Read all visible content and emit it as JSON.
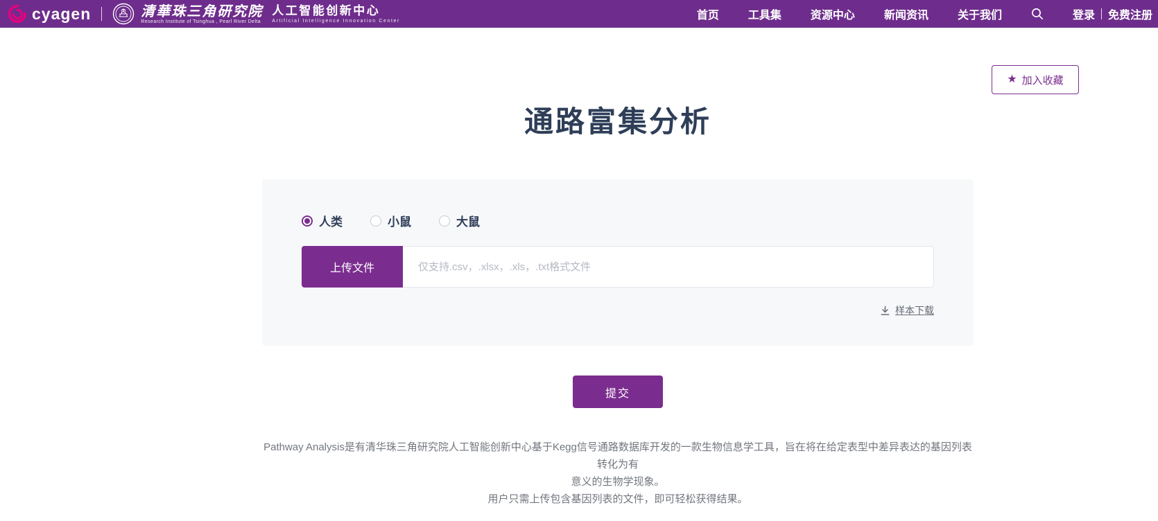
{
  "header": {
    "logo_text": "cyagen",
    "institute_name": "清華珠三角研究院",
    "institute_subtitle": "Research Institute of Tsinghua , Pearl River Delta",
    "center_name": "人工智能创新中心",
    "center_subtitle": "Artificial Intelligence Innovation Center",
    "nav": [
      "首页",
      "工具集",
      "资源中心",
      "新闻资讯",
      "关于我们"
    ],
    "login_label": "登录",
    "register_label": "免费注册"
  },
  "favorite_button": {
    "star_icon": "★",
    "label": "加入收藏"
  },
  "page_title": "通路富集分析",
  "form": {
    "species_options": [
      {
        "label": "人类",
        "selected": true
      },
      {
        "label": "小鼠",
        "selected": false
      },
      {
        "label": "大鼠",
        "selected": false
      }
    ],
    "upload_button_label": "上传文件",
    "upload_placeholder": "仅支持.csv，.xlsx，.xls，.txt格式文件",
    "upload_value": "",
    "sample_download_label": "样本下载"
  },
  "submit_label": "提交",
  "description": {
    "lines": [
      "Pathway Analysis是有清华珠三角研究院人工智能创新中心基于Kegg信号通路数据库开发的一款生物信息学工具，旨在将在给定表型中差异表达的基因列表转化为有",
      "意义的生物学现象。",
      "用户只需上传包含基因列表的文件，即可轻松获得结果。"
    ]
  },
  "colors": {
    "header_background": "#6E2D8C",
    "accent_purple": "#7B2D8F",
    "title_color": "#2E3E58",
    "card_background": "#F7F8FA",
    "logo_pink": "#E5007D"
  }
}
